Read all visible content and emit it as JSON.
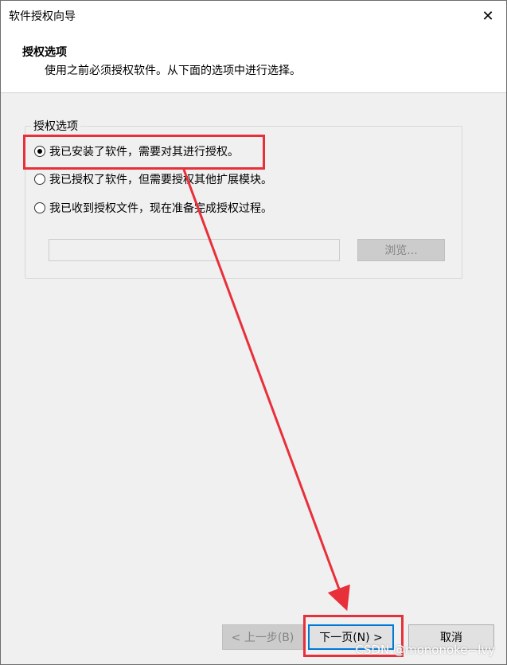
{
  "window": {
    "title": "软件授权向导",
    "close_glyph": "✕"
  },
  "header": {
    "title": "授权选项",
    "subtitle": "使用之前必须授权软件。从下面的选项中进行选择。"
  },
  "group": {
    "legend": "授权选项",
    "options": [
      {
        "label": "我已安装了软件，需要对其进行授权。",
        "checked": true
      },
      {
        "label": "我已授权了软件，但需要授权其他扩展模块。",
        "checked": false
      },
      {
        "label": "我已收到授权文件，现在准备完成授权过程。",
        "checked": false
      }
    ],
    "file_path_value": "",
    "browse_label": "浏览..."
  },
  "footer": {
    "prev_label": "< 上一步(B)",
    "next_label": "下一页(N) >",
    "cancel_label": "取消"
  },
  "annotation": {
    "highlight_color": "#e8303a",
    "focus_color": "#0078d7"
  },
  "watermark": "CSDN @mononoke−lvy"
}
